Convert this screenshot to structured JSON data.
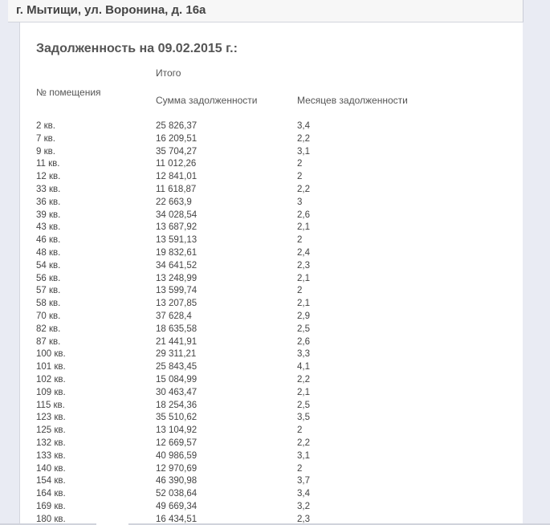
{
  "header": {
    "address": "г. Мытищи, ул. Воронина, д. 16а"
  },
  "report": {
    "title": "Задолженность на 09.02.2015 г.:",
    "col_group": "Итого",
    "col_room": "№ помещения",
    "col_sum": "Сумма задолженности",
    "col_months": "Месяцев задолженности"
  },
  "rows": [
    {
      "room": "2 кв.",
      "sum": "25 826,37",
      "months": "3,4"
    },
    {
      "room": "7 кв.",
      "sum": "16 209,51",
      "months": "2,2"
    },
    {
      "room": "9 кв.",
      "sum": "35 704,27",
      "months": "3,1"
    },
    {
      "room": "11 кв.",
      "sum": "11 012,26",
      "months": "2"
    },
    {
      "room": "12 кв.",
      "sum": "12 841,01",
      "months": "2"
    },
    {
      "room": "33 кв.",
      "sum": "11 618,87",
      "months": "2,2"
    },
    {
      "room": "36 кв.",
      "sum": "22 663,9",
      "months": "3"
    },
    {
      "room": "39 кв.",
      "sum": "34 028,54",
      "months": "2,6"
    },
    {
      "room": "43 кв.",
      "sum": "13 687,92",
      "months": "2,1"
    },
    {
      "room": "46 кв.",
      "sum": "13 591,13",
      "months": "2"
    },
    {
      "room": "48 кв.",
      "sum": "19 832,61",
      "months": "2,4"
    },
    {
      "room": "54 кв.",
      "sum": "34 641,52",
      "months": "2,3"
    },
    {
      "room": "56 кв.",
      "sum": "13 248,99",
      "months": "2,1"
    },
    {
      "room": "57 кв.",
      "sum": "13 599,74",
      "months": "2"
    },
    {
      "room": "58 кв.",
      "sum": "13 207,85",
      "months": "2,1"
    },
    {
      "room": "70 кв.",
      "sum": "37 628,4",
      "months": "2,9"
    },
    {
      "room": "82 кв.",
      "sum": "18 635,58",
      "months": "2,5"
    },
    {
      "room": "87 кв.",
      "sum": "21 441,91",
      "months": "2,6"
    },
    {
      "room": "100 кв.",
      "sum": "29 311,21",
      "months": "3,3"
    },
    {
      "room": "101 кв.",
      "sum": "25 843,45",
      "months": "4,1"
    },
    {
      "room": "102 кв.",
      "sum": "15 084,99",
      "months": "2,2"
    },
    {
      "room": "109 кв.",
      "sum": "30 463,47",
      "months": "2,1"
    },
    {
      "room": "115 кв.",
      "sum": "18 254,36",
      "months": "2,5"
    },
    {
      "room": "123 кв.",
      "sum": "35 510,62",
      "months": "3,5"
    },
    {
      "room": "125 кв.",
      "sum": "13 104,92",
      "months": "2"
    },
    {
      "room": "132 кв.",
      "sum": "12 669,57",
      "months": "2,2"
    },
    {
      "room": "133 кв.",
      "sum": "40 986,59",
      "months": "3,1"
    },
    {
      "room": "140 кв.",
      "sum": "12 970,69",
      "months": "2"
    },
    {
      "room": "154 кв.",
      "sum": "46 390,98",
      "months": "3,7"
    },
    {
      "room": "164 кв.",
      "sum": "52 038,64",
      "months": "3,4"
    },
    {
      "room": "169 кв.",
      "sum": "49 669,34",
      "months": "3,2"
    },
    {
      "room": "180 кв.",
      "sum": "16 434,51",
      "months": "2,3"
    }
  ]
}
